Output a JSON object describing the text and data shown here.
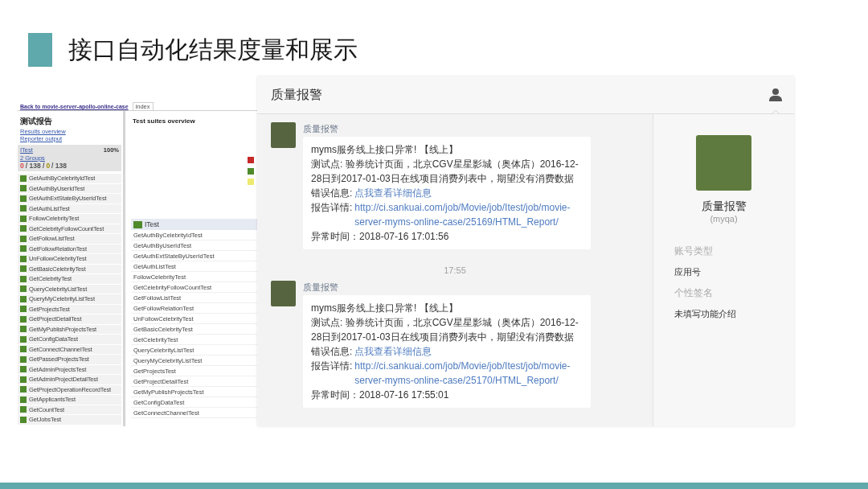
{
  "slide": {
    "title": "接口自动化结果度量和展示"
  },
  "report": {
    "back_link": "Back to movie-server-apollo-online-case",
    "tab": "index",
    "sidebar": {
      "heading": "测试报告",
      "links": [
        "Results overview",
        "Reporter output"
      ],
      "suite": {
        "name": "ITest",
        "percent": "100%",
        "groups": "2 Groups",
        "counts": [
          {
            "kind": "failed",
            "text": "0"
          },
          {
            "kind": "plain",
            "text": "/ 138 /"
          },
          {
            "kind": "skipped",
            "text": "0"
          },
          {
            "kind": "plain",
            "text": "/ 138"
          }
        ]
      },
      "tests": [
        {
          "name": "GetAuthByCelebrityIdTest",
          "passed": true
        },
        {
          "name": "GetAuthByUserIdTest",
          "passed": true
        },
        {
          "name": "GetAuthExtStateByUserIdTest",
          "passed": true
        },
        {
          "name": "GetAuthListTest",
          "passed": true
        },
        {
          "name": "FollowCelebrityTest",
          "passed": true
        },
        {
          "name": "GetCelebrityFollowCountTest",
          "passed": true
        },
        {
          "name": "GetFollowListTest",
          "passed": true
        },
        {
          "name": "GetFollowRelationTest",
          "passed": true
        },
        {
          "name": "UnFollowCelebrityTest",
          "passed": true
        },
        {
          "name": "GetBasicCelebrityTest",
          "passed": true
        },
        {
          "name": "GetCelebrityTest",
          "passed": true
        },
        {
          "name": "QueryCelebrityListTest",
          "passed": true
        },
        {
          "name": "QueryMyCelebrityListTest",
          "passed": true
        },
        {
          "name": "GetProjectsTest",
          "passed": true
        },
        {
          "name": "GetProjectDetailTest",
          "passed": true
        },
        {
          "name": "GetMyPublishProjectsTest",
          "passed": true
        },
        {
          "name": "GetConfigDataTest",
          "passed": true
        },
        {
          "name": "GetConnectChannelTest",
          "passed": true
        },
        {
          "name": "GetPassedProjectsTest",
          "passed": true
        },
        {
          "name": "GetAdminProjectsTest",
          "passed": true
        },
        {
          "name": "GetAdminProjectDetailTest",
          "passed": true
        },
        {
          "name": "GetProjectOperationRecordTest",
          "passed": true
        },
        {
          "name": "GetApplicantsTest",
          "passed": true
        },
        {
          "name": "GetCountTest",
          "passed": true
        },
        {
          "name": "GetJobsTest",
          "passed": true
        }
      ]
    },
    "overview": {
      "heading": "Test suites overview",
      "legend": [
        {
          "color": "#c62828"
        },
        {
          "color": "#4f8a2b"
        },
        {
          "color": "#eeea70"
        }
      ],
      "suite": {
        "name": "ITest",
        "passed": true
      },
      "tests": [
        "GetAuthByCelebrityIdTest",
        "GetAuthByUserIdTest",
        "GetAuthExtStateByUserIdTest",
        "GetAuthListTest",
        "FollowCelebrityTest",
        "GetCelebrityFollowCountTest",
        "GetFollowListTest",
        "GetFollowRelationTest",
        "UnFollowCelebrityTest",
        "GetBasicCelebrityTest",
        "GetCelebrityTest",
        "QueryCelebrityListTest",
        "QueryMyCelebrityListTest",
        "GetProjectsTest",
        "GetProjectDetailTest",
        "GetMyPublishProjectsTest",
        "GetConfigDataTest",
        "GetConnectChannelTest"
      ]
    }
  },
  "chat": {
    "title": "质量报警",
    "messages": [
      {
        "sender": "质量报警",
        "lines": [
          {
            "kind": "text",
            "text": "myms服务线上接口异常! 【线上】"
          },
          {
            "kind": "text",
            "text": "测试点: 验券统计页面，北京CGV星星影城（奥体店）2016-12-28日到2017-01-03日在线项目消费列表中，期望没有消费数据"
          },
          {
            "kind": "link",
            "label": "错误信息:",
            "link": "点我查看详细信息"
          },
          {
            "kind": "link",
            "label": "报告详情:",
            "link": "http://ci.sankuai.com/job/Movie/job/Itest/job/movie-server-myms-online-case/25169/HTML_Report/"
          },
          {
            "kind": "text",
            "text": "异常时间：2018-07-16 17:01:56"
          }
        ]
      },
      {
        "time": "17:55",
        "sender": "质量报警",
        "lines": [
          {
            "kind": "text",
            "text": "myms服务线上接口异常! 【线上】"
          },
          {
            "kind": "text",
            "text": "测试点: 验券统计页面，北京CGV星星影城（奥体店）2016-12-28日到2017-01-03日在线项目消费列表中，期望没有消费数据"
          },
          {
            "kind": "link",
            "label": "错误信息:",
            "link": "点我查看详细信息"
          },
          {
            "kind": "link",
            "label": "报告详情:",
            "link": "http://ci.sankuai.com/job/Movie/job/Itest/job/movie-server-myms-online-case/25170/HTML_Report/"
          },
          {
            "kind": "text",
            "text": "异常时间：2018-07-16 17:55:01"
          }
        ]
      }
    ],
    "profile": {
      "name": "质量报警",
      "account": "(myqa)",
      "fields": [
        {
          "label": "账号类型",
          "value": "应用号"
        },
        {
          "label": "个性签名",
          "value": "未填写功能介绍"
        }
      ]
    }
  }
}
